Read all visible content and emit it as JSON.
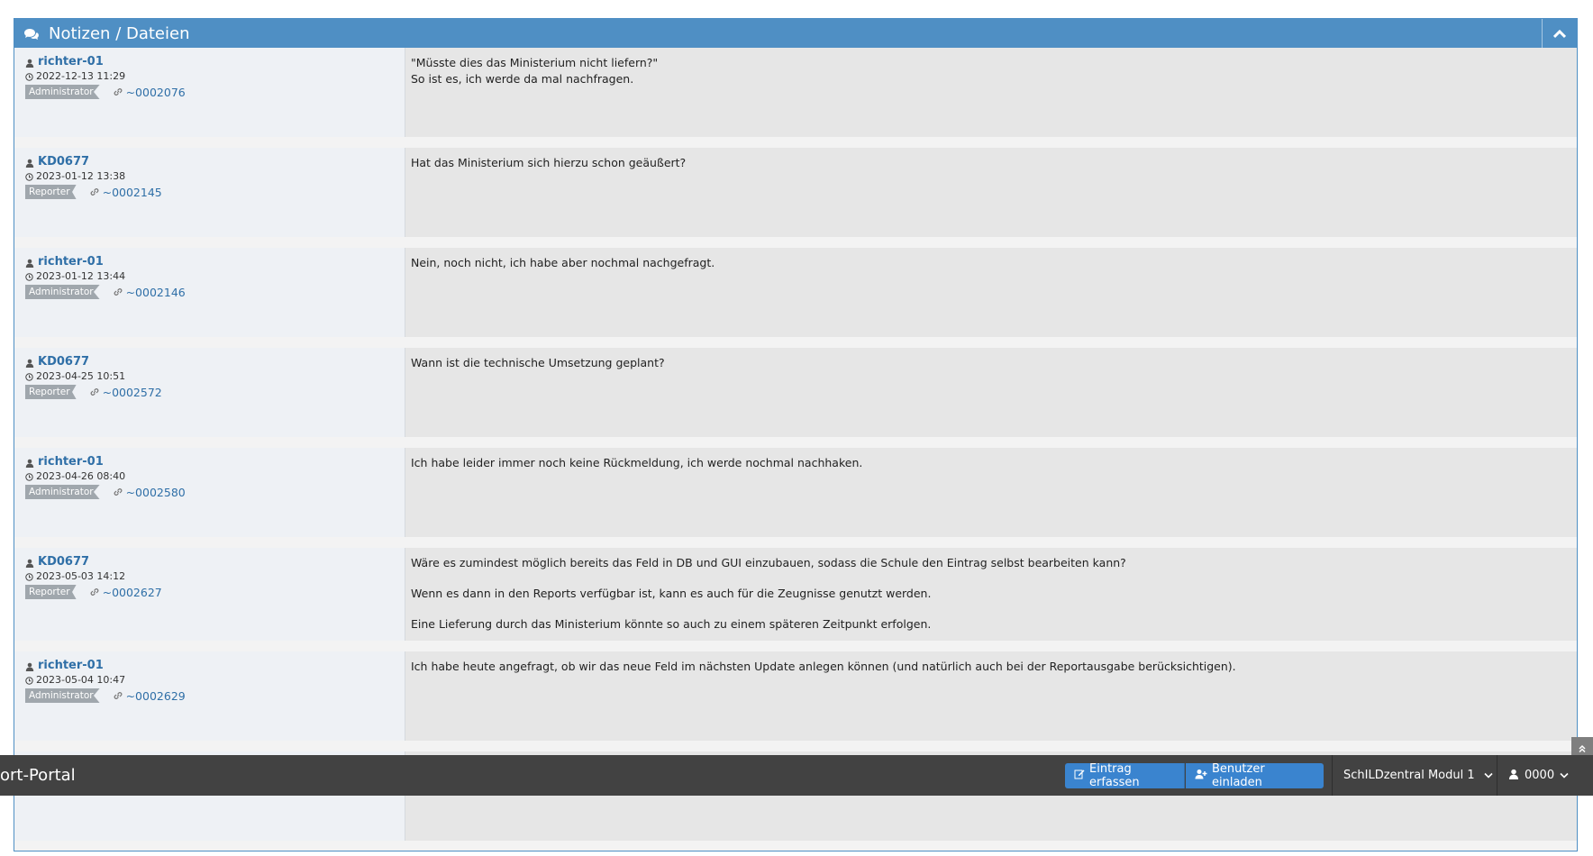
{
  "panel": {
    "title": "Notizen / Dateien",
    "icon": "comments-icon",
    "collapse_icon": "chevron-up-icon"
  },
  "notes": [
    {
      "user": "richter-01",
      "date": "2022-12-13 11:29",
      "role": "Administrator",
      "link": "~0002076",
      "lines": [
        "\"Müsste dies das Ministerium nicht liefern?\"",
        "So ist es, ich werde da mal nachfragen."
      ]
    },
    {
      "user": "KD0677",
      "date": "2023-01-12 13:38",
      "role": "Reporter",
      "link": "~0002145",
      "lines": [
        "Hat das Ministerium sich hierzu schon geäußert?"
      ]
    },
    {
      "user": "richter-01",
      "date": "2023-01-12 13:44",
      "role": "Administrator",
      "link": "~0002146",
      "lines": [
        "Nein, noch nicht, ich habe aber nochmal nachgefragt."
      ]
    },
    {
      "user": "KD0677",
      "date": "2023-04-25 10:51",
      "role": "Reporter",
      "link": "~0002572",
      "lines": [
        "Wann ist die technische Umsetzung geplant?"
      ]
    },
    {
      "user": "richter-01",
      "date": "2023-04-26 08:40",
      "role": "Administrator",
      "link": "~0002580",
      "lines": [
        "Ich habe leider immer noch keine Rückmeldung, ich werde nochmal nachhaken."
      ]
    },
    {
      "user": "KD0677",
      "date": "2023-05-03 14:12",
      "role": "Reporter",
      "link": "~0002627",
      "paragraphs": [
        "Wäre es zumindest möglich bereits das Feld in DB und GUI einzubauen, sodass die Schule den Eintrag selbst bearbeiten kann?",
        "Wenn es dann in den Reports verfügbar ist, kann es auch für die Zeugnisse genutzt werden.",
        "Eine Lieferung durch das Ministerium könnte so auch zu einem späteren Zeitpunkt erfolgen."
      ]
    },
    {
      "user": "richter-01",
      "date": "2023-05-04 10:47",
      "role": "Administrator",
      "link": "~0002629",
      "lines": [
        "Ich habe heute angefragt, ob wir das neue Feld im nächsten Update anlegen können (und natürlich auch bei der Reportausgabe berücksichtigen)."
      ]
    }
  ],
  "bottom_bar": {
    "brand": "ort-Portal",
    "btn_new_entry": "Eintrag erfassen",
    "btn_invite": "Benutzer einladen",
    "project_select": "SchILDzentral Modul 1",
    "user_menu": "0000"
  },
  "colors": {
    "header": "#4f8fc4",
    "link": "#2f6fa7",
    "button": "#3a84cf",
    "bar": "#424242"
  }
}
